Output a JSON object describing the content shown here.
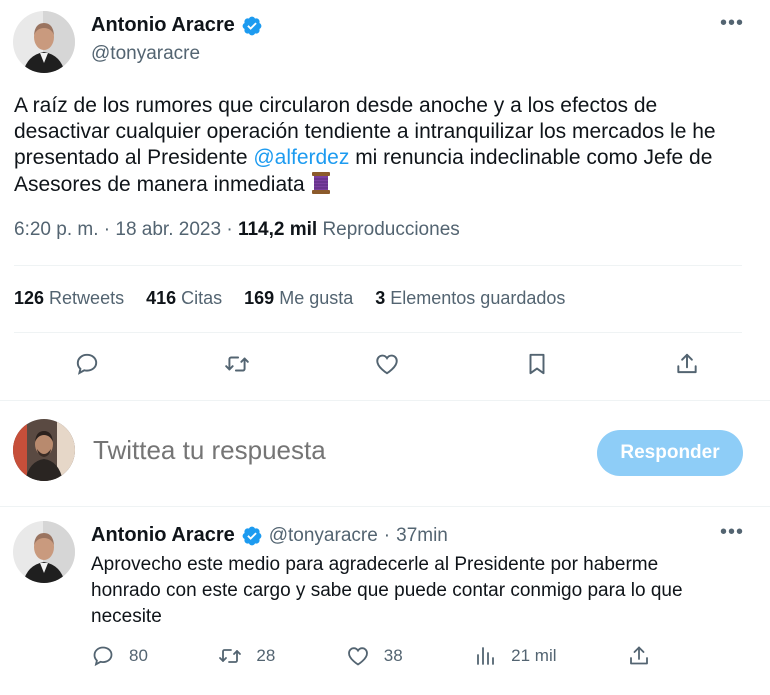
{
  "main_tweet": {
    "author_name": "Antonio Aracre",
    "handle": "@tonyaracre",
    "more_label": "•••",
    "text_part1": "A raíz de los rumores que circularon desde anoche y a los efectos de desactivar cualquier operación tendiente a intranquilizar los mercados le he presentado al Presidente ",
    "mention": "@alferdez",
    "text_part2": " mi renuncia indeclinable como Jefe de Asesores de manera inmediata ",
    "time": "6:20 p. m.",
    "sep1": " · ",
    "date": "18 abr. 2023",
    "sep2": " · ",
    "views_count": "114,2 mil",
    "views_label": " Reproducciones",
    "stats": {
      "retweets_count": "126",
      "retweets_label": " Retweets",
      "quotes_count": "416",
      "quotes_label": " Citas",
      "likes_count": "169",
      "likes_label": " Me gusta",
      "bookmarks_count": "3",
      "bookmarks_label": " Elementos guardados"
    },
    "actions": [
      "reply-icon",
      "retweet-icon",
      "like-icon",
      "bookmark-icon",
      "share-icon"
    ]
  },
  "composer": {
    "placeholder": "Twittea tu respuesta",
    "button_label": "Responder"
  },
  "reply_tweet": {
    "author_name": "Antonio Aracre",
    "handle": "@tonyaracre",
    "separator": "·",
    "time_ago": "37min",
    "more_label": "•••",
    "text": "Aprovecho este medio para agradecerle al Presidente por haberme honrado con este cargo y sabe que puede contar conmigo para lo que necesite",
    "replies": "80",
    "retweets": "28",
    "likes": "38",
    "views": "21 mil"
  },
  "colors": {
    "accent": "#1d9bf0",
    "muted": "#536471",
    "button_disabled": "#8ecdf7",
    "verified": "#1d9bf0"
  }
}
